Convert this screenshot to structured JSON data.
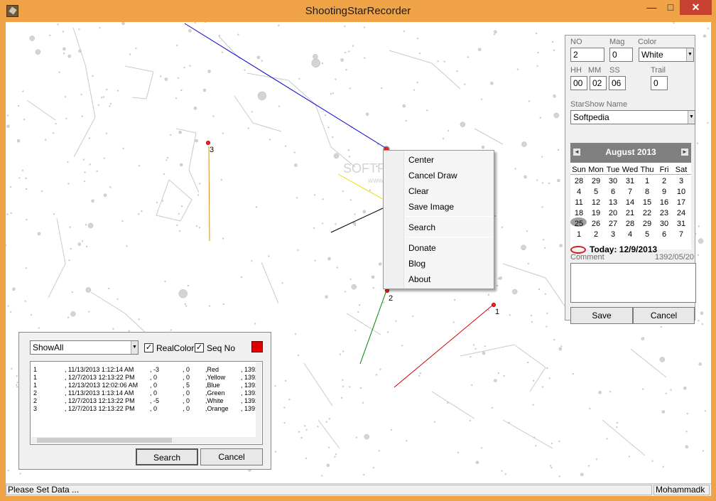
{
  "window": {
    "title": "ShootingStarRecorder"
  },
  "colors": {
    "accent": "#efa346",
    "close": "#c74133",
    "path_1": "#d40000",
    "path_2": "#008000",
    "path_3": "#d09020",
    "path_4": "#0000cc",
    "path_5": "#e8e000"
  },
  "icons": {
    "minimize": "minimize-icon",
    "maximize": "maximize-icon",
    "close": "close-icon"
  },
  "map": {
    "markers": [
      {
        "label": "1",
        "color": "#d40000"
      },
      {
        "label": "2",
        "color": "#008000"
      },
      {
        "label": "3",
        "color": "#d09020"
      }
    ]
  },
  "watermark": {
    "brand": "SOFTPEDIA",
    "url": "www.softpedia.com"
  },
  "form": {
    "no_label": "NO",
    "no_value": "2",
    "mag_label": "Mag",
    "mag_value": "0",
    "color_label": "Color",
    "color_value": "White",
    "hh_label": "HH",
    "hh_value": "00",
    "mm_label": "MM",
    "mm_value": "02",
    "ss_label": "SS",
    "ss_value": "06",
    "trail_label": "Trail",
    "trail_value": "0",
    "starshow_label": "StarShow Name",
    "starshow_value": "Softpedia",
    "comment_label": "Comment",
    "comment_date": "1392/05/20",
    "save_label": "Save",
    "cancel_label": "Cancel"
  },
  "calendar": {
    "month": "August 2013",
    "days_of_week": [
      "Sun",
      "Mon",
      "Tue",
      "Wed",
      "Thu",
      "Fri",
      "Sat"
    ],
    "weeks": [
      [
        "28",
        "29",
        "30",
        "31",
        "1",
        "2",
        "3"
      ],
      [
        "4",
        "5",
        "6",
        "7",
        "8",
        "9",
        "10"
      ],
      [
        "11",
        "12",
        "13",
        "14",
        "15",
        "16",
        "17"
      ],
      [
        "18",
        "19",
        "20",
        "21",
        "22",
        "23",
        "24"
      ],
      [
        "25",
        "26",
        "27",
        "28",
        "29",
        "30",
        "31"
      ],
      [
        "1",
        "2",
        "3",
        "4",
        "5",
        "6",
        "7"
      ]
    ],
    "today_text": "Today: 12/9/2013",
    "prev_icon": "chevron-left-icon",
    "next_icon": "chevron-right-icon"
  },
  "context_menu": {
    "items": [
      "Center",
      "Cancel Draw",
      "Clear",
      "Save Image",
      "Search",
      "Donate",
      "Blog",
      "About"
    ]
  },
  "search": {
    "filter_value": "ShowAll",
    "realcolor_label": "RealColor",
    "realcolor_checked": true,
    "seqno_label": "Seq No",
    "seqno_checked": true,
    "swatch_color": "#e00000",
    "rows": [
      {
        "seq": "1",
        "date": ", 11/13/2013 1:12:14 AM",
        "a": ", -3",
        "b": ", 0",
        "color": ",Red",
        "extra": ", 1392/"
      },
      {
        "seq": "1",
        "date": ", 12/7/2013 12:13:22 PM",
        "a": ", 0",
        "b": ", 0",
        "color": ",Yellow",
        "extra": ", 1392"
      },
      {
        "seq": "1",
        "date": ", 12/13/2013 12:02:06 AM",
        "a": ", 0",
        "b": ", 5",
        "color": ",Blue",
        "extra": ", 1392/"
      },
      {
        "seq": "2",
        "date": ", 11/13/2013 1:13:14 AM",
        "a": ", 0",
        "b": ", 0",
        "color": ",Green",
        "extra": ", 1392"
      },
      {
        "seq": "2",
        "date": ", 12/7/2013 12:13:22 PM",
        "a": ", -5",
        "b": ", 0",
        "color": ",White",
        "extra": ", 1392,"
      },
      {
        "seq": "3",
        "date": ", 12/7/2013 12:13:22 PM",
        "a": ", 0",
        "b": ", 0",
        "color": ",Orange",
        "extra": ", 139:"
      }
    ],
    "search_label": "Search",
    "cancel_label": "Cancel"
  },
  "status": {
    "message": "Please Set Data ...",
    "user": "Mohammadk"
  }
}
